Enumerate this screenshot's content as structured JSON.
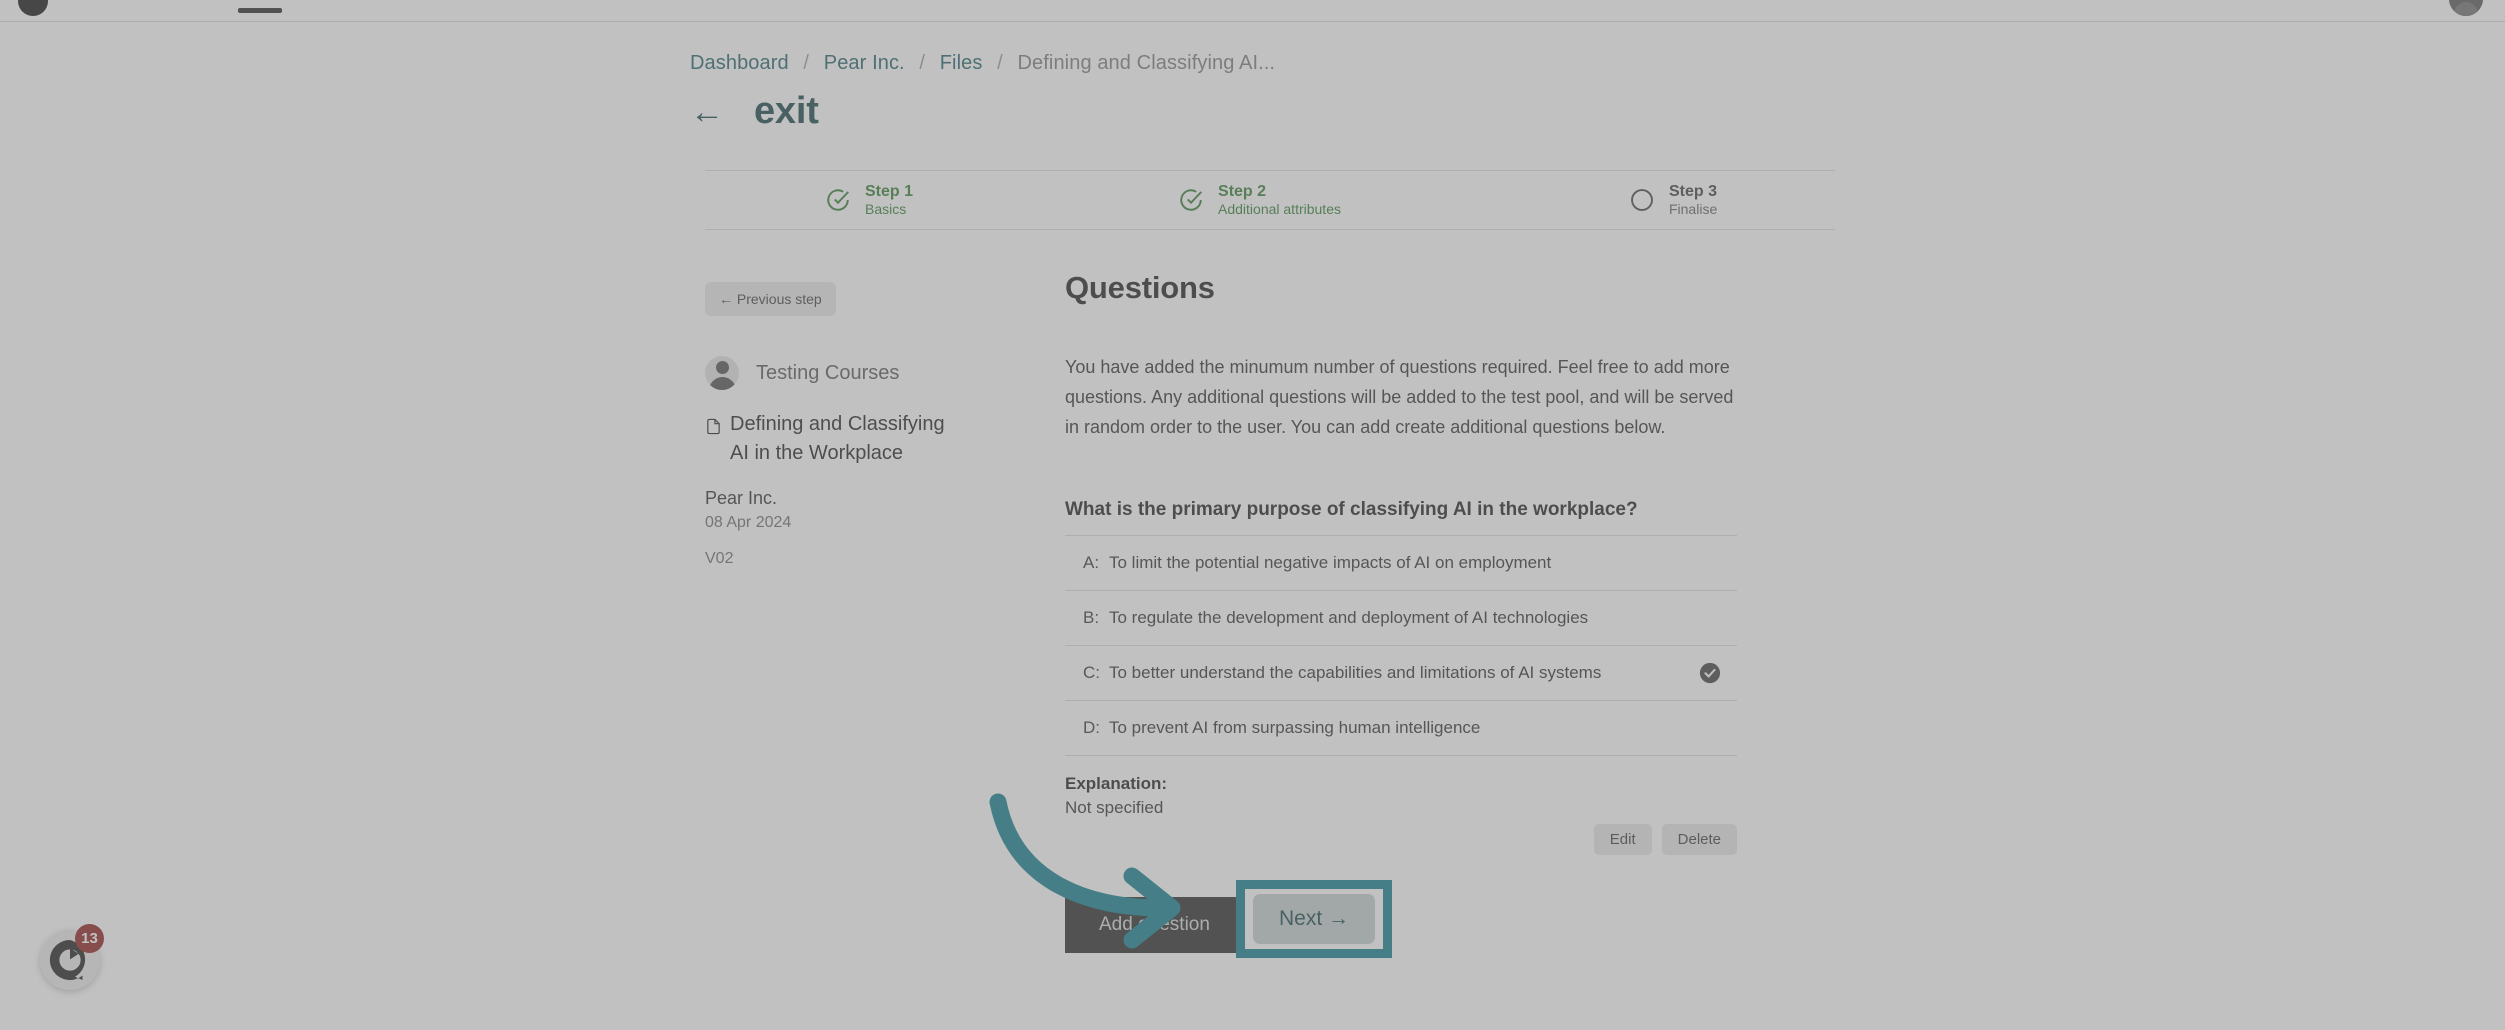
{
  "topnav": {
    "logo_icon": "brand-circle-logo",
    "avatar_icon": "user-avatar-icon"
  },
  "breadcrumb": {
    "items": [
      {
        "label": "Dashboard",
        "current": false
      },
      {
        "label": "Pear Inc.",
        "current": false
      },
      {
        "label": "Files",
        "current": false
      },
      {
        "label": "Defining and Classifying AI...",
        "current": true
      }
    ],
    "separator": "/"
  },
  "header": {
    "back_arrow": "←",
    "title": "exit"
  },
  "stepper": {
    "steps": [
      {
        "name": "Step 1",
        "sub": "Basics",
        "state": "done"
      },
      {
        "name": "Step 2",
        "sub": "Additional attributes",
        "state": "done"
      },
      {
        "name": "Step 3",
        "sub": "Finalise",
        "state": "todo"
      }
    ]
  },
  "sidebar": {
    "previous_step_label": "← Previous step",
    "owner_name": "Testing Courses",
    "file_title": "Defining and Classifying AI in the Workplace",
    "company": "Pear Inc.",
    "date": "08 Apr 2024",
    "version": "V02"
  },
  "content": {
    "heading": "Questions",
    "intro": "You have added the minumum number of questions required. Feel free to add more questions. Any additional questions will be added to the test pool, and will be served in random order to the user. You can add create additional questions below.",
    "question": {
      "text": "What is the primary purpose of classifying AI in the workplace?",
      "answers": [
        {
          "letter": "A:",
          "text": "To limit the potential negative impacts of AI on employment",
          "correct": false
        },
        {
          "letter": "B:",
          "text": "To regulate the development and deployment of AI technologies",
          "correct": false
        },
        {
          "letter": "C:",
          "text": "To better understand the capabilities and limitations of AI systems",
          "correct": true
        },
        {
          "letter": "D:",
          "text": "To prevent AI from surpassing human intelligence",
          "correct": false
        }
      ],
      "explanation_label": "Explanation:",
      "explanation_value": "Not specified",
      "edit_label": "Edit",
      "delete_label": "Delete"
    },
    "add_question_label": "Add question",
    "next_label": "Next  →"
  },
  "chat_widget": {
    "badge_count": "13",
    "icon": "chat-bubble-icon"
  },
  "annotation": {
    "highlight_color": "#0d7c8c",
    "target": "next-button"
  },
  "colors": {
    "brand_teal": "#17434a",
    "link_teal": "#1e5f66",
    "step_done_green": "#2f7d32",
    "annotation_teal": "#0d7c8c",
    "dark_button": "#262626",
    "next_button_bg": "#c3cfcf",
    "badge_red": "#8d1a1a"
  }
}
